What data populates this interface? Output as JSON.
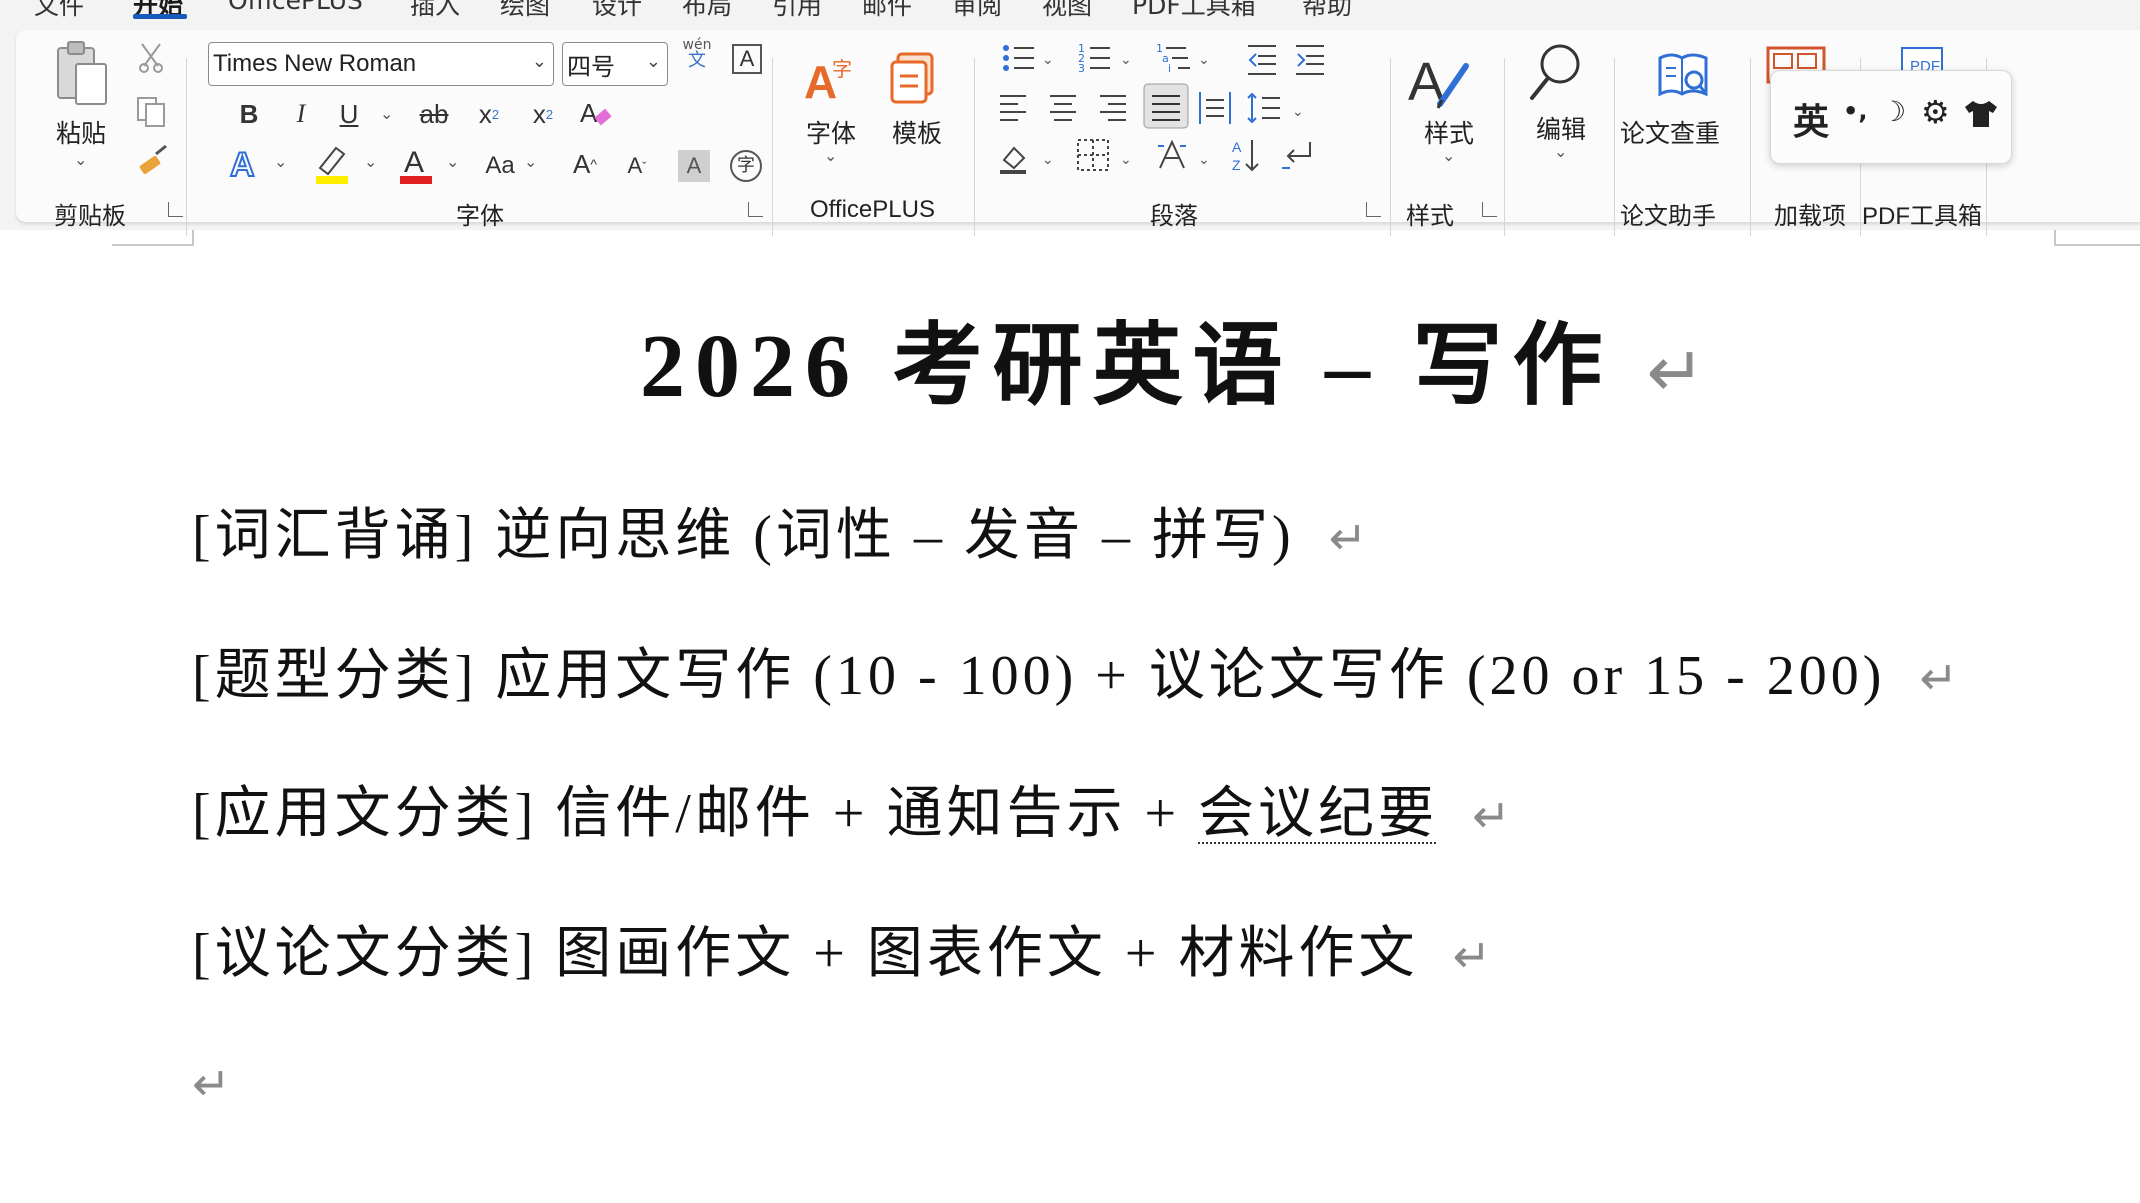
{
  "tabs": {
    "file": "文件",
    "home": "开始",
    "officeplus": "OfficePLUS",
    "insert": "插入",
    "draw": "绘图",
    "design": "设计",
    "layout": "布局",
    "references": "引用",
    "mailings": "邮件",
    "review": "审阅",
    "view": "视图",
    "pdf": "PDF工具箱",
    "help": "帮助"
  },
  "ribbon": {
    "clipboard": {
      "paste_label": "粘贴",
      "group_label": "剪贴板"
    },
    "font": {
      "font_name": "Times New Roman",
      "font_size": "四号",
      "phonetic_top": "wén",
      "phonetic_bottom": "文",
      "bold": "B",
      "italic": "I",
      "underline": "U",
      "strike": "ab",
      "subscript": "x",
      "superscript": "x",
      "effects": "A",
      "font_color": "A",
      "change_case": "Aa",
      "grow": "A",
      "shrink": "A",
      "shading": "A",
      "enclose": "字",
      "group_label": "字体",
      "highlight_color": "#ffee00",
      "font_color_value": "#e02020"
    },
    "officeplus": {
      "font_label": "字体",
      "template_label": "模板",
      "group_label": "OfficePLUS"
    },
    "paragraph": {
      "group_label": "段落"
    },
    "styles": {
      "styles_label": "样式",
      "group_label": "样式"
    },
    "editing": {
      "edit_label": "编辑"
    },
    "thesis": {
      "check_label": "论文查重",
      "group_label": "论文助手"
    },
    "addins": {
      "group_label": "加载项"
    },
    "pdf": {
      "badge": "PDF",
      "group_label": "PDF工具箱"
    }
  },
  "ime": {
    "lang": "英",
    "punct": "•,",
    "moon": "☽",
    "gear": "⚙",
    "skin": "👕"
  },
  "document": {
    "title": "2026 考研英语 – 写作",
    "lines": [
      "[词汇背诵] 逆向思维 (词性 – 发音 – 拼写)",
      "[题型分类] 应用文写作 (10 - 100) + 议论文写作 (20 or 15 - 200)",
      "[应用文分类] 信件/邮件 + 通知告示 + ",
      "[议论文分类] 图画作文 + 图表作文 + 材料作文"
    ],
    "line3_dotted": "会议纪要",
    "pilcrow": "↵"
  }
}
